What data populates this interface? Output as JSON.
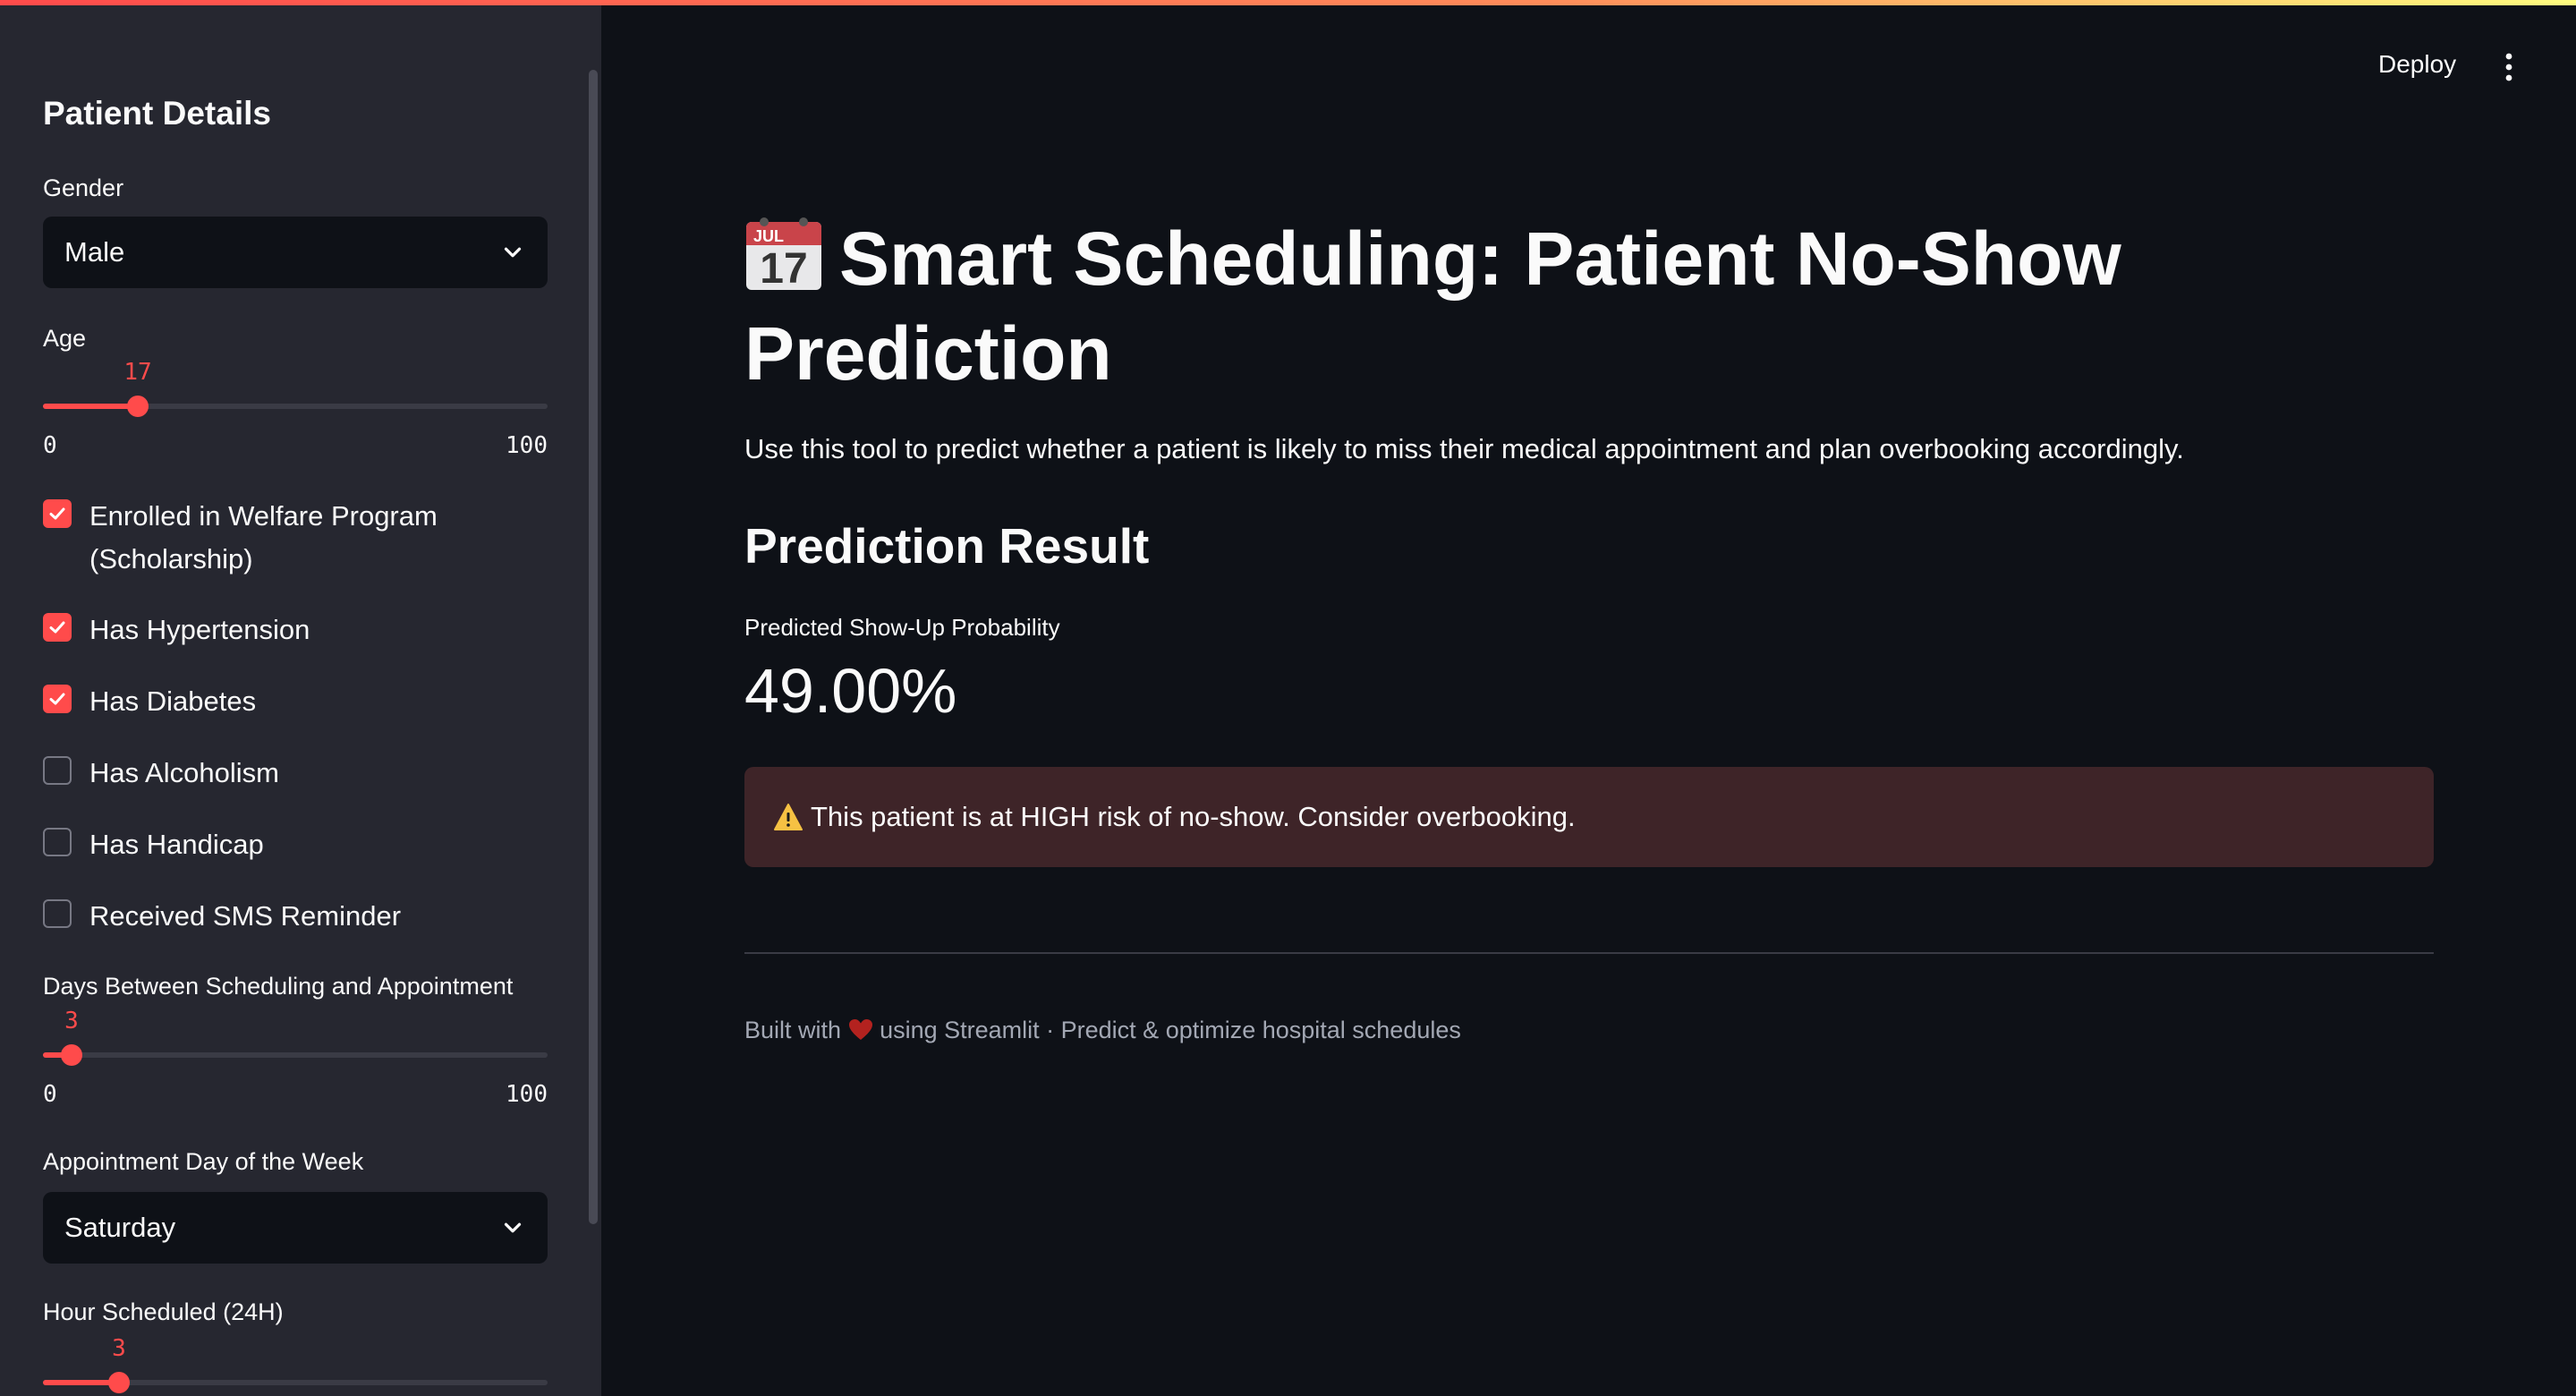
{
  "sidebar": {
    "heading": "Patient Details",
    "gender": {
      "label": "Gender",
      "value": "Male"
    },
    "age": {
      "label": "Age",
      "value": "17",
      "value_fraction": 0.17,
      "min": "0",
      "max": "100"
    },
    "checkboxes": [
      {
        "label": "Enrolled in Welfare Program",
        "label_line2": "(Scholarship)",
        "checked": true
      },
      {
        "label": "Has Hypertension",
        "checked": true
      },
      {
        "label": "Has Diabetes",
        "checked": true
      },
      {
        "label": "Has Alcoholism",
        "checked": false
      },
      {
        "label": "Has Handicap",
        "checked": false
      },
      {
        "label": "Received SMS Reminder",
        "checked": false
      }
    ],
    "days_between": {
      "label": "Days Between Scheduling and Appointment",
      "value": "3",
      "value_fraction": 0.03,
      "min": "0",
      "max": "100"
    },
    "weekday": {
      "label": "Appointment Day of the Week",
      "value": "Saturday"
    },
    "hour": {
      "label": "Hour Scheduled (24H)",
      "value": "3",
      "value_fraction": 0.13
    }
  },
  "header": {
    "deploy_label": "Deploy",
    "menu_icon": "vertical-ellipsis-icon"
  },
  "main": {
    "title_icon": "calendar-icon",
    "title_icon_month": "JUL",
    "title_icon_day": "17",
    "title_line1": "Smart Scheduling: Patient No-Show",
    "title_line2": "Prediction",
    "subtitle": "Use this tool to predict whether a patient is likely to miss their medical appointment and plan overbooking accordingly.",
    "result_heading": "Prediction Result",
    "metric_label": "Predicted Show-Up Probability",
    "metric_value": "49.00%",
    "alert_text": "This patient is at HIGH risk of no-show. Consider overbooking.",
    "footer_before": "Built with",
    "footer_after": "using Streamlit · Predict & optimize hospital schedules"
  },
  "colors": {
    "accent": "#ff4b4b",
    "background": "#0e1117",
    "sidebar": "#262730",
    "alert_bg": "#3e2428"
  }
}
